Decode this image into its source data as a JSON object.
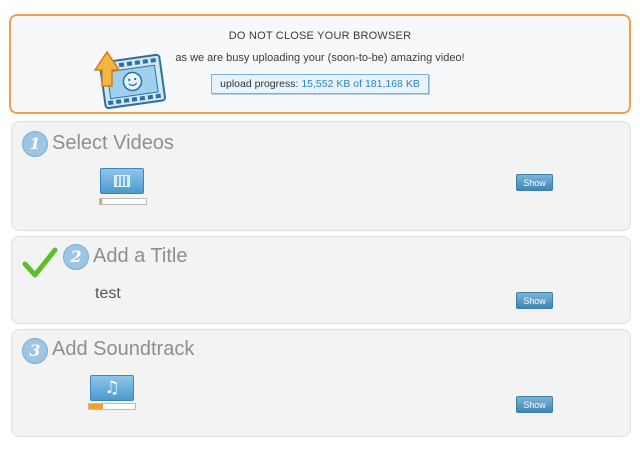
{
  "upload_notice": {
    "headline": "DO NOT CLOSE YOUR BROWSER",
    "message": "as we are busy uploading your (soon-to-be) amazing video!",
    "progress_label": "upload progress:",
    "progress_value": "15,552 KB of 181,168 KB",
    "border_color": "#f0a04a"
  },
  "steps": [
    {
      "number": "1",
      "title": "Select Videos",
      "show_label": "Show",
      "icon": "film-icon",
      "progress_fraction": 0.04
    },
    {
      "number": "2",
      "title": "Add a Title",
      "value": "test",
      "show_label": "Show",
      "completed_icon": "checkmark-icon"
    },
    {
      "number": "3",
      "title": "Add Soundtrack",
      "show_label": "Show",
      "icon": "music-note-icon",
      "progress_fraction": 0.3
    }
  ],
  "colors": {
    "accent_blue": "#3f86b6",
    "step_number": "#9cc6e4",
    "progress_fill": "#f2a12e",
    "check_green": "#5cbf2a"
  }
}
